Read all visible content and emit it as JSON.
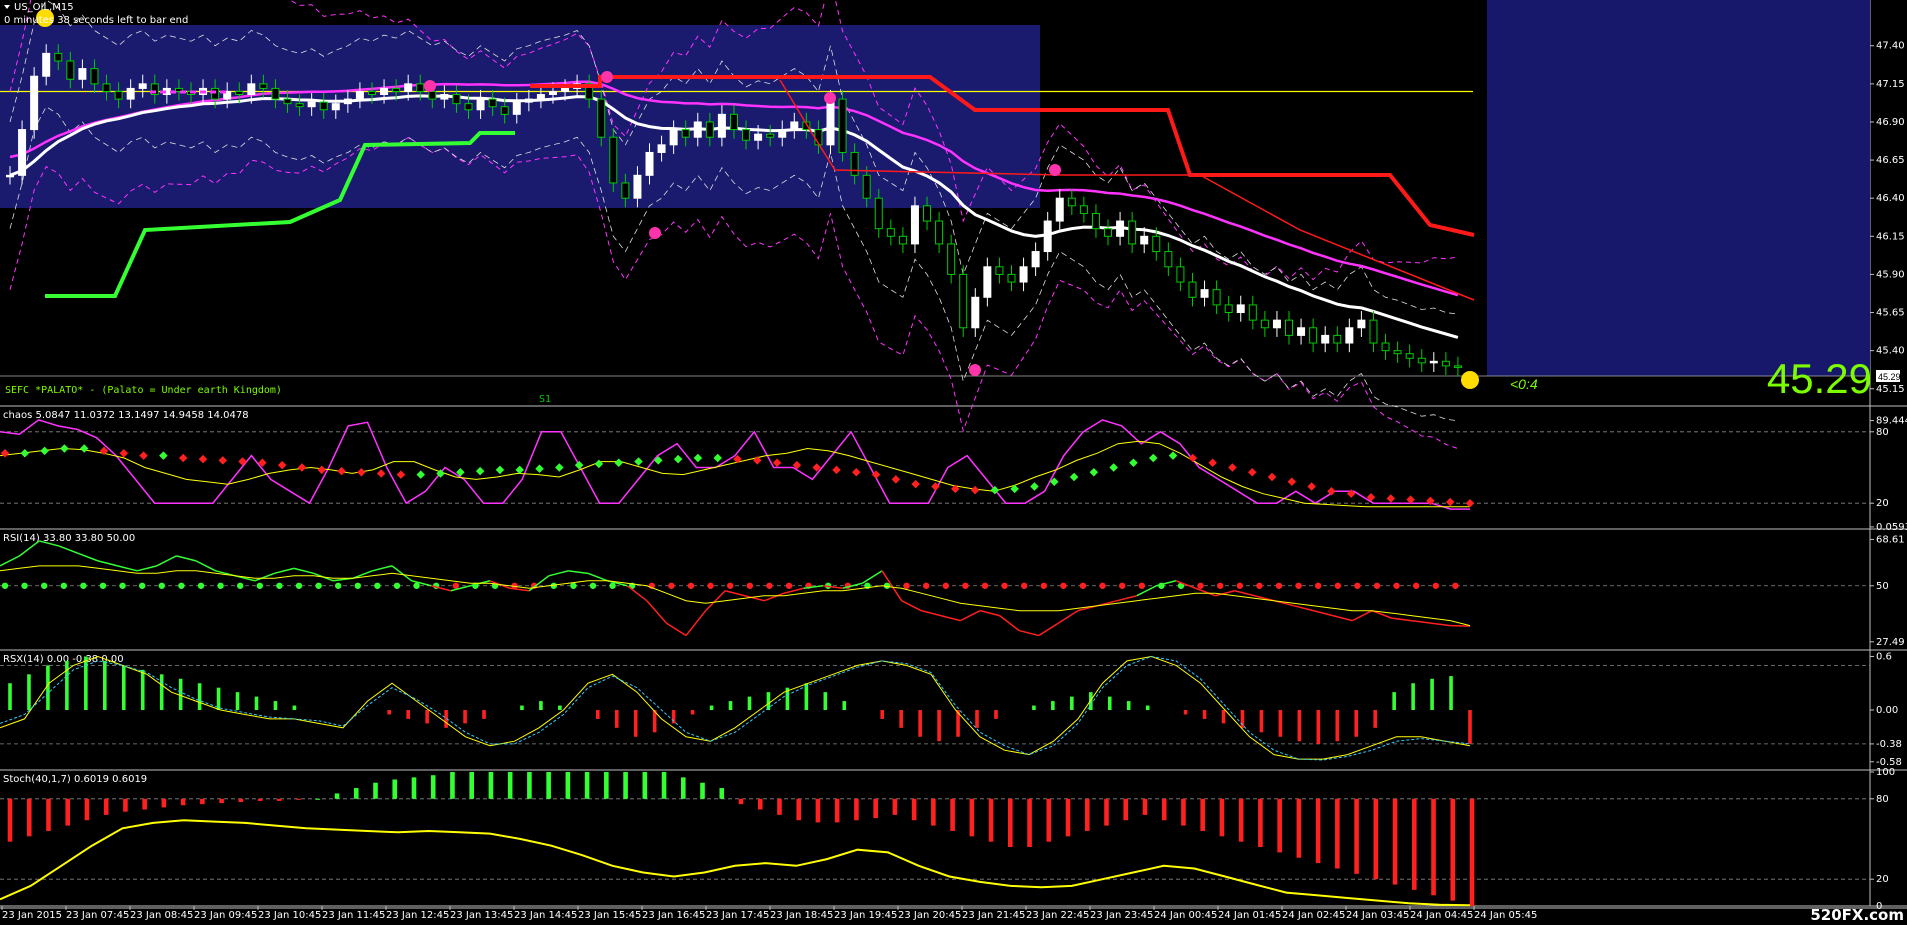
{
  "window": {
    "symbol_title": "US_OIL,M15",
    "countdown": "0 minutes 38 seconds left to bar end",
    "indicator_caption": "SEFC *PALATO* - (Palato = Under earth Kingdom)",
    "s1_label": "S1",
    "big_price": "45.29",
    "small_price_tag": "45.29",
    "countdown_short": "<0:4",
    "watermark": "520FX.com"
  },
  "colors": {
    "background": "#000000",
    "overlay_box": "#1a1a6e",
    "right_panel": "#17186b",
    "price_green": "#7cfc00",
    "bull_candle": "#ffffff",
    "bear_candle": "#00cc00",
    "red_line": "#ff1a1a",
    "magenta_line": "#ff33ff",
    "yellow_line": "#ffff00",
    "white_ma": "#ffffff"
  },
  "chart_data": [
    {
      "panel": "price",
      "type": "candlestick",
      "title": "US_OIL,M15",
      "y_ticks": [
        "47.40",
        "47.15",
        "46.90",
        "46.65",
        "46.40",
        "46.15",
        "45.90",
        "45.65",
        "45.40",
        "45.15"
      ],
      "ylim": [
        45.05,
        47.7
      ],
      "horizontal_line": 47.1,
      "last_price": 45.29,
      "x_categories": [
        "23 Jan 2015",
        "23 Jan 07:45",
        "23 Jan 08:45",
        "23 Jan 09:45",
        "23 Jan 10:45",
        "23 Jan 11:45",
        "23 Jan 12:45",
        "23 Jan 13:45",
        "23 Jan 14:45",
        "23 Jan 15:45",
        "23 Jan 16:45",
        "23 Jan 17:45",
        "23 Jan 18:45",
        "23 Jan 19:45",
        "23 Jan 20:45",
        "23 Jan 21:45",
        "23 Jan 22:45",
        "23 Jan 23:45",
        "24 Jan 00:45",
        "24 Jan 01:45",
        "24 Jan 02:45",
        "24 Jan 03:45",
        "24 Jan 04:45",
        "24 Jan 05:45"
      ],
      "closes": [
        46.55,
        46.85,
        47.2,
        47.35,
        47.3,
        47.18,
        47.25,
        47.15,
        47.1,
        47.05,
        47.12,
        47.15,
        47.08,
        47.12,
        47.1,
        47.08,
        47.12,
        47.05,
        47.1,
        47.08,
        47.15,
        47.12,
        47.05,
        47.02,
        47.0,
        47.03,
        46.98,
        47.02,
        47.05,
        47.1,
        47.08,
        47.12,
        47.1,
        47.15,
        47.1,
        47.05,
        47.08,
        47.02,
        46.98,
        47.05,
        47.0,
        46.95,
        47.03,
        47.05,
        47.08,
        47.1,
        47.12,
        47.15,
        47.05,
        46.8,
        46.5,
        46.4,
        46.55,
        46.7,
        46.75,
        46.85,
        46.8,
        46.9,
        46.8,
        46.95,
        46.85,
        46.78,
        46.82,
        46.8,
        46.85,
        46.9,
        46.85,
        46.75,
        47.05,
        46.7,
        46.55,
        46.4,
        46.2,
        46.15,
        46.1,
        46.35,
        46.25,
        46.1,
        45.9,
        45.55,
        45.75,
        45.95,
        45.9,
        45.85,
        45.95,
        46.05,
        46.25,
        46.4,
        46.35,
        46.3,
        46.2,
        46.15,
        46.25,
        46.1,
        46.15,
        46.05,
        45.95,
        45.85,
        45.75,
        45.8,
        45.7,
        45.65,
        45.7,
        45.6,
        45.55,
        45.6,
        45.5,
        45.55,
        45.45,
        45.5,
        45.45,
        45.55,
        45.6,
        45.45,
        45.4,
        45.38,
        45.35,
        45.32,
        45.33,
        45.3,
        45.29
      ],
      "moving_averages": [
        "white",
        "magenta",
        "red step",
        "green step"
      ],
      "series_names": []
    },
    {
      "panel": "chaos",
      "type": "line",
      "title": "chaos 5.0847 11.0372 13.1497 14.9458 14.0478",
      "y_ticks": [
        "89.4444",
        "80",
        "20",
        "0.0593"
      ],
      "ylim": [
        0,
        100
      ],
      "magenta": [
        80,
        78,
        90,
        85,
        82,
        75,
        60,
        40,
        20,
        20,
        20,
        20,
        40,
        60,
        40,
        30,
        20,
        50,
        85,
        88,
        50,
        20,
        30,
        50,
        40,
        20,
        20,
        40,
        80,
        80,
        50,
        20,
        20,
        40,
        60,
        70,
        50,
        50,
        60,
        80,
        50,
        50,
        40,
        60,
        80,
        50,
        20,
        20,
        20,
        50,
        60,
        40,
        20,
        20,
        30,
        60,
        80,
        90,
        85,
        70,
        80,
        70,
        50,
        40,
        30,
        20,
        20,
        30,
        20,
        30,
        30,
        20,
        20,
        20,
        20,
        15,
        15
      ],
      "yellow": [
        60,
        62,
        64,
        66,
        65,
        62,
        58,
        50,
        45,
        40,
        38,
        36,
        40,
        45,
        48,
        50,
        48,
        45,
        48,
        55,
        55,
        48,
        42,
        40,
        42,
        45,
        44,
        42,
        48,
        55,
        55,
        50,
        45,
        44,
        48,
        52,
        56,
        60,
        62,
        66,
        64,
        60,
        55,
        50,
        45,
        40,
        35,
        32,
        30,
        35,
        42,
        48,
        56,
        62,
        70,
        72,
        70,
        62,
        52,
        42,
        34,
        28,
        24,
        20,
        19,
        18,
        17,
        17,
        17,
        17,
        17,
        17
      ],
      "dots": [
        62,
        62,
        64,
        66,
        66,
        64,
        62,
        60,
        60,
        58,
        57,
        56,
        55,
        54,
        52,
        50,
        48,
        47,
        46,
        45,
        44,
        44,
        45,
        46,
        47,
        48,
        48,
        49,
        50,
        52,
        53,
        54,
        55,
        56,
        57,
        58,
        58,
        57,
        56,
        54,
        52,
        50,
        48,
        46,
        44,
        40,
        36,
        34,
        32,
        31,
        31,
        32,
        34,
        38,
        42,
        46,
        50,
        54,
        58,
        60,
        58,
        54,
        50,
        46,
        42,
        38,
        34,
        30,
        28,
        25,
        24,
        23,
        22,
        21,
        20
      ],
      "series_names": []
    },
    {
      "panel": "rsi",
      "type": "line",
      "title": "RSI(14) 33.80 33.80 50.00",
      "y_ticks": [
        "68.61",
        "50",
        "27.49"
      ],
      "ylim": [
        25,
        72
      ],
      "level": 50,
      "rsi": [
        58,
        62,
        68,
        66,
        63,
        60,
        58,
        56,
        58,
        62,
        60,
        56,
        54,
        52,
        55,
        57,
        55,
        52,
        53,
        56,
        58,
        52,
        50,
        48,
        50,
        52,
        49,
        48,
        54,
        56,
        55,
        52,
        50,
        44,
        35,
        30,
        40,
        48,
        46,
        44,
        47,
        49,
        50,
        49,
        51,
        56,
        44,
        40,
        38,
        36,
        40,
        38,
        32,
        30,
        35,
        40,
        42,
        44,
        46,
        50,
        52,
        49,
        46,
        48,
        46,
        44,
        42,
        40,
        38,
        36,
        40,
        37,
        36,
        35,
        34,
        33.8
      ],
      "signal": [
        56,
        57,
        58,
        58,
        58,
        57,
        56,
        55,
        55,
        56,
        56,
        55,
        54,
        53,
        53,
        54,
        54,
        53,
        53,
        54,
        55,
        54,
        53,
        52,
        51,
        51,
        50,
        49,
        50,
        51,
        52,
        52,
        51,
        50,
        47,
        44,
        43,
        44,
        45,
        46,
        46,
        47,
        48,
        48,
        49,
        50,
        49,
        47,
        45,
        43,
        42,
        41,
        40,
        40,
        40,
        41,
        42,
        43,
        44,
        45,
        46,
        47,
        47,
        46,
        45,
        44,
        43,
        42,
        41,
        40,
        40,
        39,
        38,
        37,
        36,
        34
      ],
      "series_names": []
    },
    {
      "panel": "rsx",
      "type": "bar",
      "title": "RSX(14) 0.00 -0.38 0.00",
      "y_ticks": [
        "0.6",
        "0.00",
        "-0.38",
        "-0.58"
      ],
      "ylim": [
        -0.65,
        0.65
      ],
      "histogram": [
        0.3,
        0.4,
        0.5,
        0.55,
        0.6,
        0.55,
        0.5,
        0.45,
        0.4,
        0.35,
        0.3,
        0.25,
        0.2,
        0.15,
        0.1,
        0.05,
        0,
        0,
        0,
        0,
        -0.05,
        -0.1,
        -0.15,
        -0.2,
        -0.15,
        -0.1,
        0,
        0.05,
        0.1,
        0.05,
        0,
        -0.1,
        -0.2,
        -0.3,
        -0.25,
        -0.15,
        -0.05,
        0.05,
        0.1,
        0.15,
        0.2,
        0.25,
        0.3,
        0.2,
        0.1,
        0,
        -0.1,
        -0.2,
        -0.3,
        -0.35,
        -0.3,
        -0.2,
        -0.1,
        0,
        0.05,
        0.1,
        0.15,
        0.2,
        0.15,
        0.1,
        0.05,
        0,
        -0.05,
        -0.1,
        -0.15,
        -0.2,
        -0.25,
        -0.3,
        -0.35,
        -0.38,
        -0.35,
        -0.3,
        -0.2,
        0.2,
        0.3,
        0.35,
        0.38,
        -0.38
      ],
      "line1": [
        -0.2,
        -0.1,
        0.3,
        0.5,
        0.6,
        0.5,
        0.4,
        0.2,
        0.1,
        0,
        -0.05,
        -0.1,
        -0.1,
        -0.15,
        -0.2,
        0.1,
        0.3,
        0.1,
        -0.1,
        -0.3,
        -0.4,
        -0.35,
        -0.2,
        0,
        0.3,
        0.4,
        0.2,
        -0.1,
        -0.3,
        -0.35,
        -0.2,
        0,
        0.2,
        0.3,
        0.4,
        0.5,
        0.55,
        0.5,
        0.4,
        0,
        -0.3,
        -0.45,
        -0.5,
        -0.35,
        -0.1,
        0.3,
        0.55,
        0.6,
        0.5,
        0.3,
        0,
        -0.3,
        -0.5,
        -0.55,
        -0.55,
        -0.5,
        -0.4,
        -0.3,
        -0.3,
        -0.35,
        -0.4
      ],
      "line2": [
        -0.15,
        -0.05,
        0.2,
        0.45,
        0.55,
        0.5,
        0.42,
        0.25,
        0.12,
        0.02,
        -0.03,
        -0.08,
        -0.1,
        -0.12,
        -0.18,
        0.05,
        0.25,
        0.12,
        -0.05,
        -0.25,
        -0.38,
        -0.38,
        -0.25,
        -0.05,
        0.25,
        0.38,
        0.25,
        0,
        -0.25,
        -0.35,
        -0.25,
        -0.05,
        0.15,
        0.28,
        0.38,
        0.48,
        0.55,
        0.52,
        0.42,
        0.05,
        -0.25,
        -0.4,
        -0.5,
        -0.4,
        -0.15,
        0.25,
        0.5,
        0.6,
        0.55,
        0.35,
        0.05,
        -0.25,
        -0.45,
        -0.55,
        -0.56,
        -0.52,
        -0.45,
        -0.35,
        -0.32,
        -0.35,
        -0.38
      ],
      "series_names": []
    },
    {
      "panel": "stoch",
      "type": "bar",
      "title": "Stoch(40,1,7) 0.6019 0.6019",
      "y_ticks": [
        "100",
        "80",
        "20",
        "0"
      ],
      "ylim": [
        0,
        100
      ],
      "histogram": [
        -40,
        -35,
        -30,
        -25,
        -20,
        -15,
        -12,
        -10,
        -8,
        -6,
        -5,
        -4,
        -3,
        -2,
        -2,
        -1,
        0,
        5,
        10,
        15,
        18,
        20,
        22,
        25,
        25,
        25,
        25,
        25,
        25,
        25,
        25,
        25,
        25,
        25,
        25,
        20,
        15,
        10,
        -5,
        -10,
        -15,
        -20,
        -22,
        -22,
        -20,
        -18,
        -15,
        -20,
        -25,
        -30,
        -35,
        -40,
        -45,
        -45,
        -40,
        -35,
        -30,
        -25,
        -20,
        -15,
        -20,
        -25,
        -30,
        -35,
        -40,
        -45,
        -50,
        -55,
        -60,
        -65,
        -70,
        -75,
        -80,
        -85,
        -90,
        -95,
        -100
      ],
      "line": [
        5,
        15,
        30,
        45,
        58,
        62,
        64,
        63,
        62,
        60,
        58,
        57,
        56,
        55,
        56,
        55,
        54,
        50,
        45,
        38,
        30,
        25,
        22,
        25,
        30,
        32,
        30,
        35,
        42,
        40,
        30,
        22,
        18,
        15,
        14,
        15,
        20,
        25,
        30,
        28,
        22,
        16,
        10,
        8,
        6,
        4,
        2,
        1,
        0.6
      ],
      "series_names": []
    }
  ]
}
